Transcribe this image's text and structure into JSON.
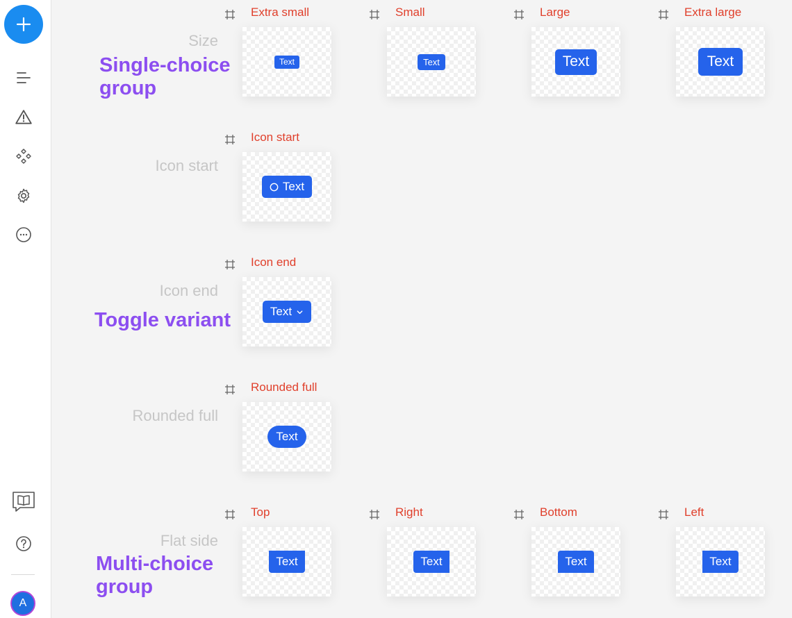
{
  "sidebar": {
    "fab_icon": "plus-icon",
    "nav_icons": [
      "list-icon",
      "warning-icon",
      "components-icon",
      "gear-icon",
      "more-icon"
    ],
    "bottom_icons": [
      "book-chat-icon",
      "help-icon"
    ],
    "avatar_initial": "A"
  },
  "headings": {
    "single_choice": "Single-choice group",
    "toggle_variant": "Toggle variant",
    "multi_choice": "Multi-choice group"
  },
  "rows": {
    "size": {
      "label": "Size",
      "frames": [
        {
          "title": "Extra small",
          "button": "Text"
        },
        {
          "title": "Small",
          "button": "Text"
        },
        {
          "title": "Large",
          "button": "Text"
        },
        {
          "title": "Extra large",
          "button": "Text"
        }
      ]
    },
    "icon_start": {
      "label": "Icon start",
      "frames": [
        {
          "title": "Icon start",
          "button": "Text",
          "icon": "circle-icon"
        }
      ]
    },
    "icon_end": {
      "label": "Icon end",
      "frames": [
        {
          "title": "Icon end",
          "button": "Text",
          "icon": "chevron-down-icon"
        }
      ]
    },
    "rounded_full": {
      "label": "Rounded full",
      "frames": [
        {
          "title": "Rounded full",
          "button": "Text"
        }
      ]
    },
    "flat_side": {
      "label": "Flat side",
      "frames": [
        {
          "title": "Top",
          "button": "Text"
        },
        {
          "title": "Right",
          "button": "Text"
        },
        {
          "title": "Bottom",
          "button": "Text"
        },
        {
          "title": "Left",
          "button": "Text"
        }
      ]
    }
  },
  "colors": {
    "accent": "#2563eb",
    "heading": "#8c4ef0",
    "frame_label": "#e0402c",
    "row_label": "#c6c6c6",
    "fab": "#1a8cf0"
  }
}
